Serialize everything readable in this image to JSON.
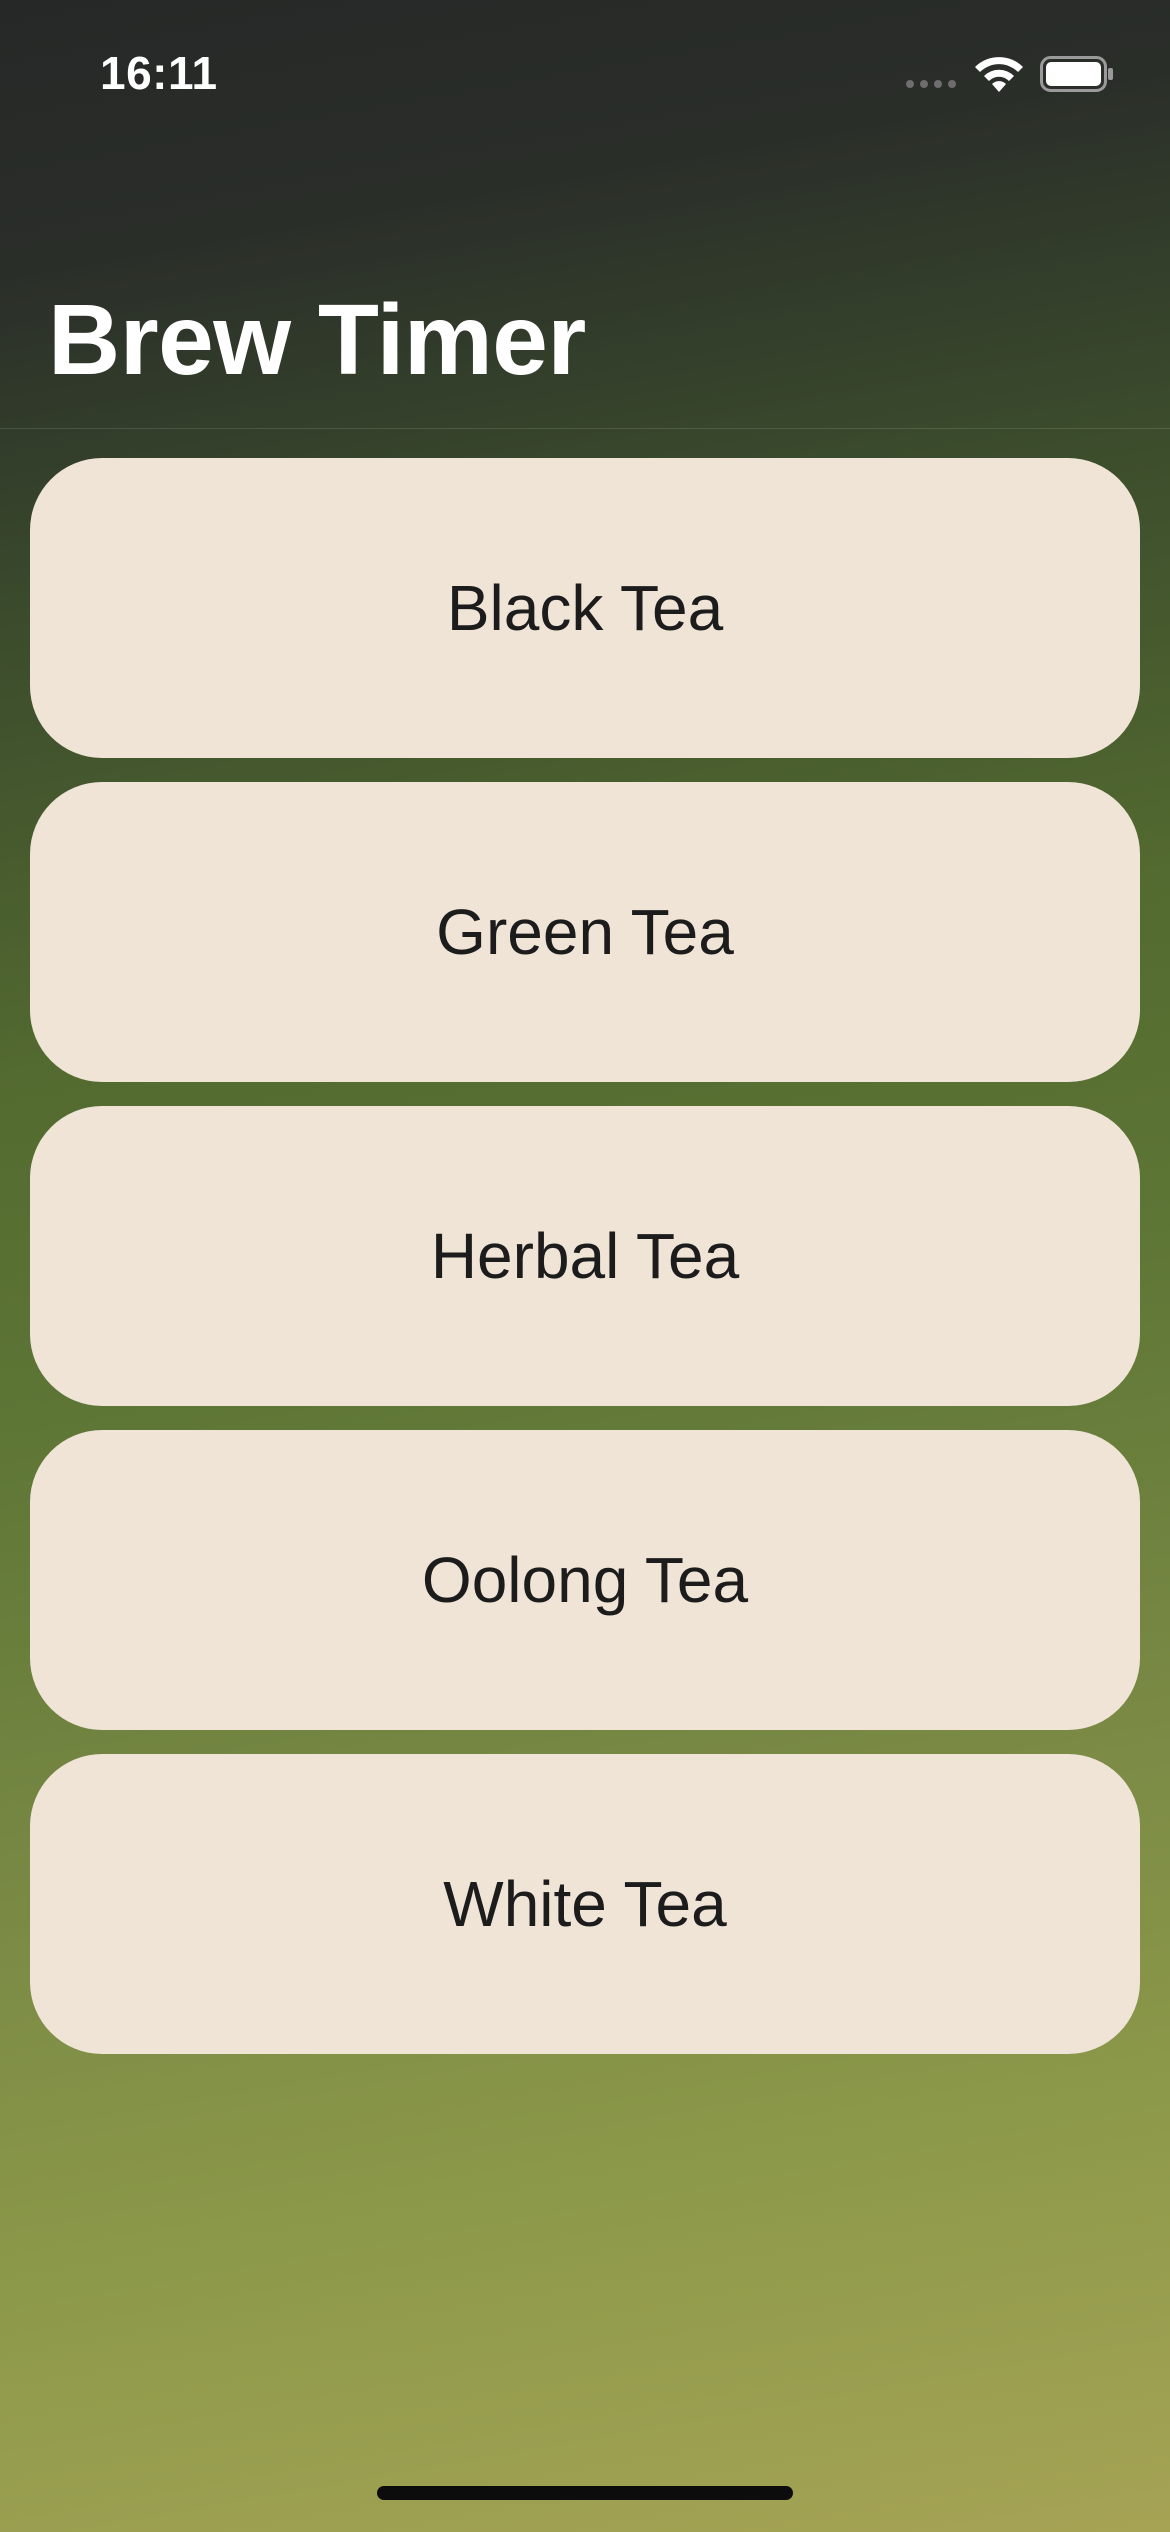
{
  "status_bar": {
    "time": "16:11",
    "icons": [
      "cellular-signal-icon",
      "wifi-icon",
      "battery-icon"
    ]
  },
  "header": {
    "title": "Brew Timer"
  },
  "tea_list": {
    "items": [
      {
        "label": "Black Tea"
      },
      {
        "label": "Green Tea"
      },
      {
        "label": "Herbal Tea"
      },
      {
        "label": "Oolong Tea"
      },
      {
        "label": "White Tea"
      }
    ]
  },
  "colors": {
    "card_background": "#efe4d6",
    "card_text": "#1c1c1c",
    "title_text": "#ffffff",
    "gradient_top": "#262827",
    "gradient_mid": "#546b30",
    "gradient_bottom": "#a6a355"
  }
}
